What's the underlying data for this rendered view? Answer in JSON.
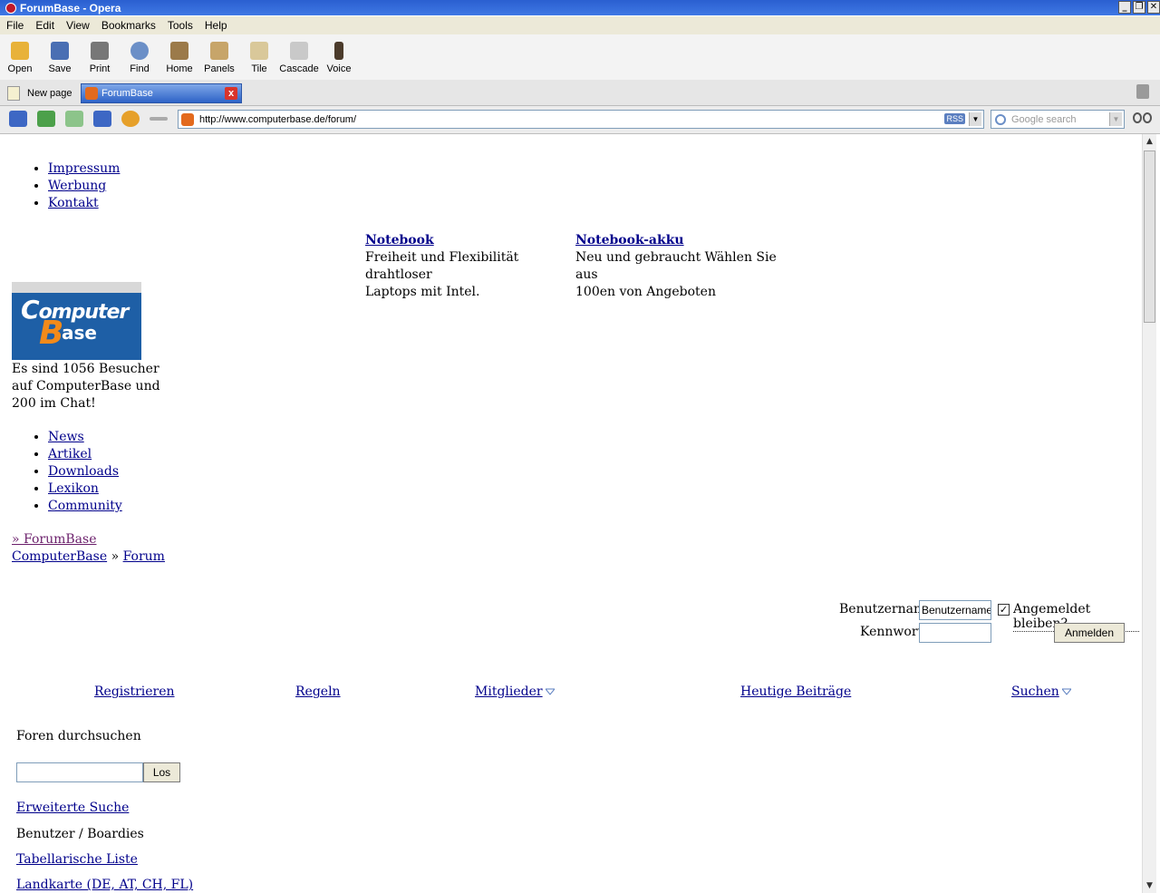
{
  "window": {
    "title": "ForumBase - Opera",
    "buttons": [
      "_",
      "❐",
      "✕"
    ]
  },
  "menu": [
    "File",
    "Edit",
    "View",
    "Bookmarks",
    "Tools",
    "Help"
  ],
  "toolbar": [
    {
      "label": "Open",
      "icon": "folder-icon",
      "color": "#e8b23a"
    },
    {
      "label": "Save",
      "icon": "floppy-icon",
      "color": "#4a6fb3"
    },
    {
      "label": "Print",
      "icon": "printer-icon",
      "color": "#777777"
    },
    {
      "label": "Find",
      "icon": "magnifier-icon",
      "color": "#6b8fc7"
    },
    {
      "label": "Home",
      "icon": "home-icon",
      "color": "#9b7a4a"
    },
    {
      "label": "Panels",
      "icon": "panels-icon",
      "color": "#c7a56a"
    },
    {
      "label": "Tile",
      "icon": "tile-icon",
      "color": "#d9c89a"
    },
    {
      "label": "Cascade",
      "icon": "cascade-icon",
      "color": "#c9c9c9"
    },
    {
      "label": "Voice",
      "icon": "microphone-icon",
      "color": "#4b3b2b"
    }
  ],
  "tabs": {
    "new_page": "New page",
    "active": "ForumBase",
    "close": "x"
  },
  "address": {
    "url": "http://www.computerbase.de/forum/",
    "rss": "RSS",
    "search_placeholder": "Google search"
  },
  "page": {
    "top_links": [
      "Impressum",
      "Werbung",
      "Kontakt"
    ],
    "ads": [
      {
        "title": "Notebook",
        "text_line1": "Freiheit und Flexibilität drahtloser",
        "text_line2": "Laptops mit Intel."
      },
      {
        "title": "Notebook-akku",
        "text_line1": "Neu und gebraucht Wählen Sie aus",
        "text_line2": "100en von Angeboten"
      }
    ],
    "logo": {
      "word1": "omputer",
      "letter_c": "C",
      "letter_b": "B",
      "word2": "ase"
    },
    "visitors_line1": "Es sind 1056 Besucher",
    "visitors_line2": "auf ComputerBase und",
    "visitors_line3": "200 im Chat!",
    "main_nav": [
      "News",
      "Artikel",
      "Downloads",
      "Lexikon",
      "Community"
    ],
    "breadcrumb_current": "» ForumBase",
    "breadcrumb_root": "ComputerBase",
    "breadcrumb_sep": "»",
    "breadcrumb_forum": "Forum",
    "login": {
      "username_label": "Benutzername",
      "username_value": "Benutzername",
      "remember_label": "Angemeldet bleiben?",
      "password_label": "Kennwort",
      "submit": "Anmelden"
    },
    "actions": [
      "Registrieren",
      "Regeln",
      "Mitglieder",
      "Heutige Beiträge",
      "Suchen"
    ],
    "search_forums_label": "Foren durchsuchen",
    "search_go": "Los",
    "advanced_search": "Erweiterte Suche",
    "members_heading": "Benutzer / Boardies",
    "members_list": "Tabellarische Liste",
    "members_map": "Landkarte (DE, AT, CH, FL)"
  }
}
